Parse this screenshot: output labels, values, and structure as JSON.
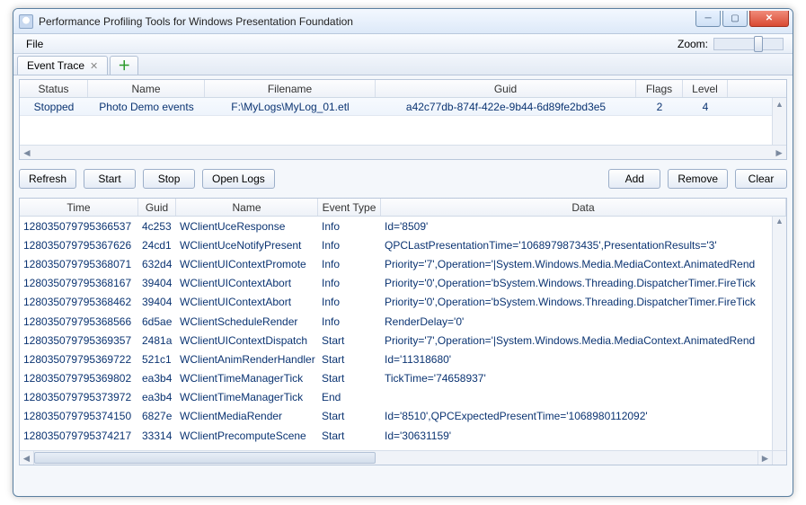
{
  "window": {
    "title": "Performance Profiling Tools for Windows Presentation Foundation"
  },
  "menubar": {
    "file": "File",
    "zoom_label": "Zoom:"
  },
  "tabs": {
    "active": "Event Trace"
  },
  "trace_grid": {
    "headers": {
      "status": "Status",
      "name": "Name",
      "filename": "Filename",
      "guid": "Guid",
      "flags": "Flags",
      "level": "Level"
    },
    "row": {
      "status": "Stopped",
      "name": "Photo Demo events",
      "filename": "F:\\MyLogs\\MyLog_01.etl",
      "guid": "a42c77db-874f-422e-9b44-6d89fe2bd3e5",
      "flags": "2",
      "level": "4"
    }
  },
  "buttons": {
    "refresh": "Refresh",
    "start": "Start",
    "stop": "Stop",
    "open_logs": "Open Logs",
    "add": "Add",
    "remove": "Remove",
    "clear": "Clear"
  },
  "events_grid": {
    "headers": {
      "time": "Time",
      "guid": "Guid",
      "name": "Name",
      "event_type": "Event Type",
      "data": "Data"
    },
    "rows": [
      {
        "time": "128035079795366537",
        "guid": "4c253",
        "name": "WClientUceResponse",
        "etype": "Info",
        "data": "Id='8509'"
      },
      {
        "time": "128035079795367626",
        "guid": "24cd1",
        "name": "WClientUceNotifyPresent",
        "etype": "Info",
        "data": "QPCLastPresentationTime='1068979873435',PresentationResults='3'"
      },
      {
        "time": "128035079795368071",
        "guid": "632d4",
        "name": "WClientUIContextPromote",
        "etype": "Info",
        "data": "Priority='7',Operation='|System.Windows.Media.MediaContext.AnimatedRend"
      },
      {
        "time": "128035079795368167",
        "guid": "39404",
        "name": "WClientUIContextAbort",
        "etype": "Info",
        "data": "Priority='0',Operation='bSystem.Windows.Threading.DispatcherTimer.FireTick"
      },
      {
        "time": "128035079795368462",
        "guid": "39404",
        "name": "WClientUIContextAbort",
        "etype": "Info",
        "data": "Priority='0',Operation='bSystem.Windows.Threading.DispatcherTimer.FireTick"
      },
      {
        "time": "128035079795368566",
        "guid": "6d5ae",
        "name": "WClientScheduleRender",
        "etype": "Info",
        "data": "RenderDelay='0'"
      },
      {
        "time": "128035079795369357",
        "guid": "2481a",
        "name": "WClientUIContextDispatch",
        "etype": "Start",
        "data": "Priority='7',Operation='|System.Windows.Media.MediaContext.AnimatedRend"
      },
      {
        "time": "128035079795369722",
        "guid": "521c1",
        "name": "WClientAnimRenderHandler",
        "etype": "Start",
        "data": "Id='11318680'"
      },
      {
        "time": "128035079795369802",
        "guid": "ea3b4",
        "name": "WClientTimeManagerTick",
        "etype": "Start",
        "data": "TickTime='74658937'"
      },
      {
        "time": "128035079795373972",
        "guid": "ea3b4",
        "name": "WClientTimeManagerTick",
        "etype": "End",
        "data": ""
      },
      {
        "time": "128035079795374150",
        "guid": "6827e",
        "name": "WClientMediaRender",
        "etype": "Start",
        "data": "Id='8510',QPCExpectedPresentTime='1068980112092'"
      },
      {
        "time": "128035079795374217",
        "guid": "33314",
        "name": "WClientPrecomputeScene",
        "etype": "Start",
        "data": "Id='30631159'"
      }
    ]
  }
}
